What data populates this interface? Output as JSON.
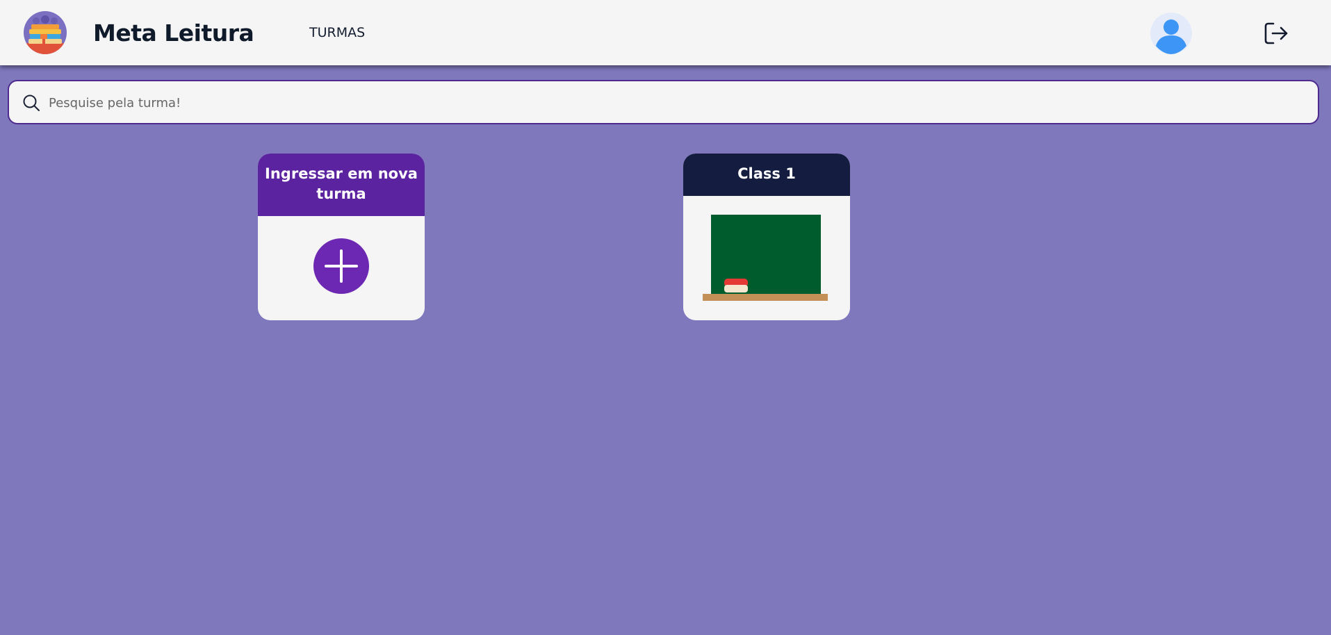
{
  "header": {
    "brand": "Meta Leitura",
    "nav_turmas": "TURMAS"
  },
  "search": {
    "placeholder": "Pesquise pela turma!",
    "value": ""
  },
  "cards": {
    "join": {
      "title": "Ingressar em nova turma"
    },
    "classes": [
      {
        "title": "Class 1"
      }
    ]
  },
  "colors": {
    "background": "#7f78bd",
    "header": "#f5f5f5",
    "join_accent": "#5b23a0",
    "plus_circle": "#6d28b3",
    "class_header": "#141c40",
    "chalkboard": "#005b2d"
  },
  "icons": {
    "logo": "books-logo-icon",
    "avatar": "user-avatar-icon",
    "logout": "logout-icon",
    "search": "search-icon",
    "plus": "plus-icon",
    "class": "chalkboard-icon"
  }
}
